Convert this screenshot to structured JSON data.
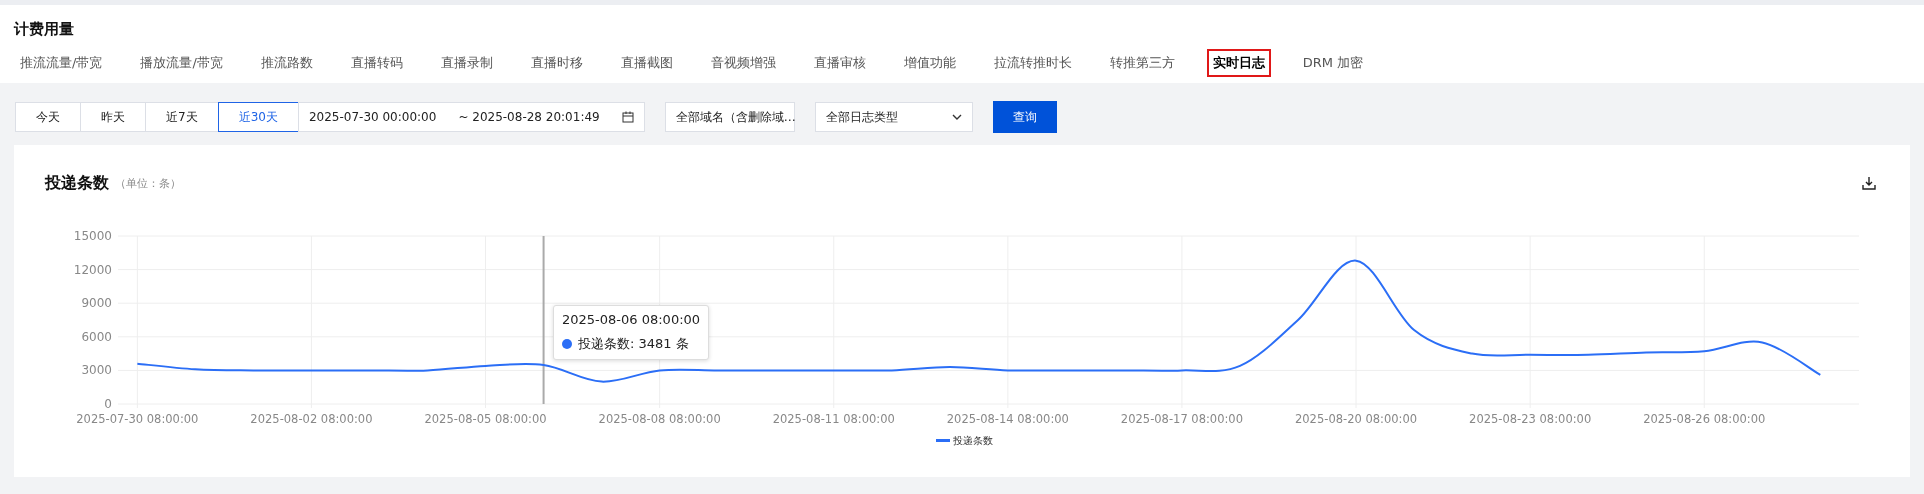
{
  "page_title": "计费用量",
  "tabs": [
    {
      "label": "推流流量/带宽",
      "selected": false
    },
    {
      "label": "播放流量/带宽",
      "selected": false
    },
    {
      "label": "推流路数",
      "selected": false
    },
    {
      "label": "直播转码",
      "selected": false
    },
    {
      "label": "直播录制",
      "selected": false
    },
    {
      "label": "直播时移",
      "selected": false
    },
    {
      "label": "直播截图",
      "selected": false
    },
    {
      "label": "音视频增强",
      "selected": false
    },
    {
      "label": "直播审核",
      "selected": false
    },
    {
      "label": "增值功能",
      "selected": false
    },
    {
      "label": "拉流转推时长",
      "selected": false
    },
    {
      "label": "转推第三方",
      "selected": false
    },
    {
      "label": "实时日志",
      "selected": true
    },
    {
      "label": "DRM 加密",
      "selected": false
    }
  ],
  "filters": {
    "ranges": [
      {
        "label": "今天",
        "selected": false
      },
      {
        "label": "昨天",
        "selected": false
      },
      {
        "label": "近7天",
        "selected": false
      },
      {
        "label": "近30天",
        "selected": true
      }
    ],
    "start": "2025-07-30 00:00:00",
    "end": "~ 2025-08-28 20:01:49",
    "domain_select": "全部域名（含删除域…",
    "log_type_select": "全部日志类型",
    "query_button": "查询"
  },
  "card": {
    "title": "投递条数",
    "unit": "（单位：条）",
    "tooltip": {
      "time": "2025-08-06 08:00:00",
      "text": "投递条数: 3481 条"
    },
    "chart_data": {
      "type": "line",
      "grid": true,
      "xlim": [
        "2025-07-30 00:00:00",
        "2025-08-29 00:00:00"
      ],
      "ref_lines": [
        {
          "axis": "x",
          "value": "2025-08-06 08:00:00",
          "color": "#aaaaaa"
        }
      ],
      "x": [
        "2025-07-30 08:00:00",
        "2025-07-31 08:00:00",
        "2025-08-01 08:00:00",
        "2025-08-02 08:00:00",
        "2025-08-03 08:00:00",
        "2025-08-04 08:00:00",
        "2025-08-05 08:00:00",
        "2025-08-06 08:00:00",
        "2025-08-07 08:00:00",
        "2025-08-08 08:00:00",
        "2025-08-09 08:00:00",
        "2025-08-10 08:00:00",
        "2025-08-11 08:00:00",
        "2025-08-12 08:00:00",
        "2025-08-13 08:00:00",
        "2025-08-14 08:00:00",
        "2025-08-15 08:00:00",
        "2025-08-16 08:00:00",
        "2025-08-17 08:00:00",
        "2025-08-18 08:00:00",
        "2025-08-19 08:00:00",
        "2025-08-20 08:00:00",
        "2025-08-21 08:00:00",
        "2025-08-22 08:00:00",
        "2025-08-23 08:00:00",
        "2025-08-24 08:00:00",
        "2025-08-25 08:00:00",
        "2025-08-26 08:00:00",
        "2025-08-27 08:00:00",
        "2025-08-28 08:00:00"
      ],
      "xticks": [
        "2025-07-30 08:00:00",
        "2025-08-02 08:00:00",
        "2025-08-05 08:00:00",
        "2025-08-08 08:00:00",
        "2025-08-11 08:00:00",
        "2025-08-14 08:00:00",
        "2025-08-17 08:00:00",
        "2025-08-20 08:00:00",
        "2025-08-23 08:00:00",
        "2025-08-26 08:00:00"
      ],
      "ylim": [
        0,
        15000
      ],
      "yticks": [
        0,
        3000,
        6000,
        9000,
        12000,
        15000
      ],
      "series": [
        {
          "name": "投递条数",
          "color": "#2b6ef6",
          "values": [
            3600,
            3100,
            3000,
            3000,
            3000,
            3000,
            3400,
            3481,
            2000,
            3000,
            3000,
            3000,
            3000,
            3000,
            3300,
            3000,
            3000,
            3000,
            3000,
            3400,
            7500,
            12800,
            6600,
            4500,
            4400,
            4400,
            4600,
            4700,
            5500,
            2600
          ]
        }
      ]
    }
  }
}
